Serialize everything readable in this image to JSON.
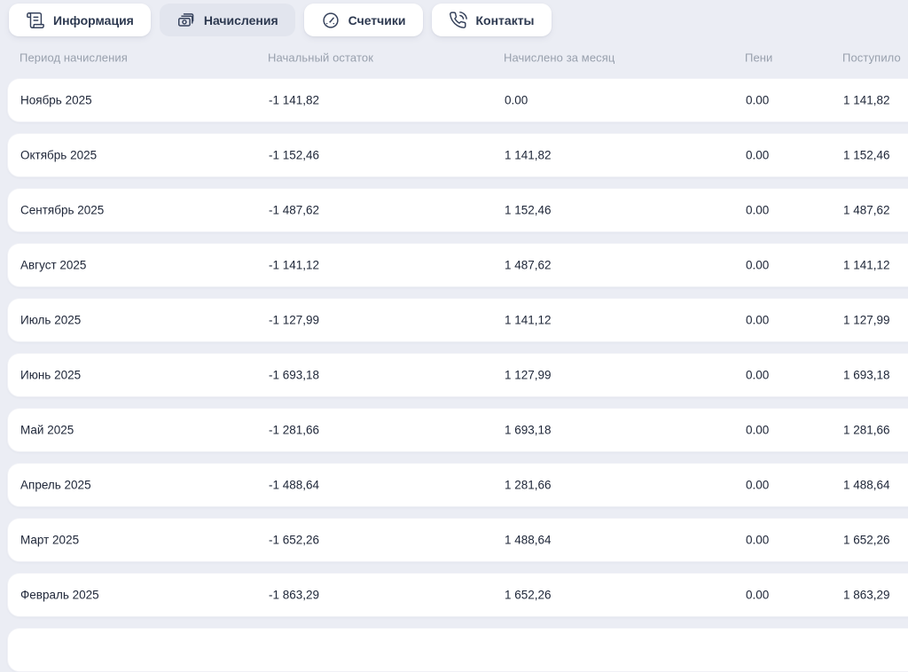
{
  "tabs": [
    {
      "label": "Информация",
      "icon": "scroll-icon",
      "active": false
    },
    {
      "label": "Начисления",
      "icon": "banknotes-icon",
      "active": true
    },
    {
      "label": "Счетчики",
      "icon": "gauge-icon",
      "active": false
    },
    {
      "label": "Контакты",
      "icon": "phone-icon",
      "active": false
    }
  ],
  "table": {
    "columns": [
      "Период начисления",
      "Начальный остаток",
      "Начислено за месяц",
      "Пени",
      "Поступило"
    ],
    "rows": [
      {
        "period": "Ноябрь 2025",
        "opening_balance": "-1 141,82",
        "accrued": "0.00",
        "penalty": "0.00",
        "received": "1 141,82"
      },
      {
        "period": "Октябрь 2025",
        "opening_balance": "-1 152,46",
        "accrued": "1 141,82",
        "penalty": "0.00",
        "received": "1 152,46"
      },
      {
        "period": "Сентябрь 2025",
        "opening_balance": "-1 487,62",
        "accrued": "1 152,46",
        "penalty": "0.00",
        "received": "1 487,62"
      },
      {
        "period": "Август 2025",
        "opening_balance": "-1 141,12",
        "accrued": "1 487,62",
        "penalty": "0.00",
        "received": "1 141,12"
      },
      {
        "period": "Июль 2025",
        "opening_balance": "-1 127,99",
        "accrued": "1 141,12",
        "penalty": "0.00",
        "received": "1 127,99"
      },
      {
        "period": "Июнь 2025",
        "opening_balance": "-1 693,18",
        "accrued": "1 127,99",
        "penalty": "0.00",
        "received": "1 693,18"
      },
      {
        "period": "Май 2025",
        "opening_balance": "-1 281,66",
        "accrued": "1 693,18",
        "penalty": "0.00",
        "received": "1 281,66"
      },
      {
        "period": "Апрель 2025",
        "opening_balance": "-1 488,64",
        "accrued": "1 281,66",
        "penalty": "0.00",
        "received": "1 488,64"
      },
      {
        "period": "Март 2025",
        "opening_balance": "-1 652,26",
        "accrued": "1 488,64",
        "penalty": "0.00",
        "received": "1 652,26"
      },
      {
        "period": "Февраль 2025",
        "opening_balance": "-1 863,29",
        "accrued": "1 652,26",
        "penalty": "0.00",
        "received": "1 863,29"
      }
    ],
    "has_partial_next_row": true
  },
  "colors": {
    "page_background": "#ebedf4",
    "card_background": "#ffffff",
    "active_tab_background": "#e2e5ee",
    "header_text": "#98a0ad",
    "cell_text": "#20283a",
    "tab_text": "#2d3950"
  }
}
